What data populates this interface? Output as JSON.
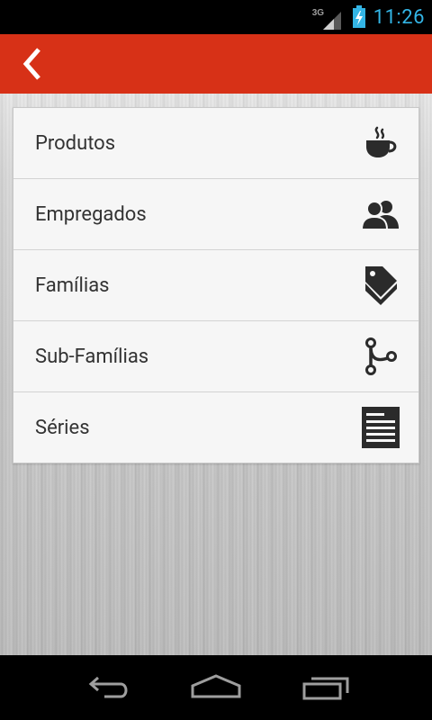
{
  "status_bar": {
    "network": "3G",
    "time": "11:26"
  },
  "action_bar": {
    "back_icon": "chevron-left-icon"
  },
  "menu": {
    "items": [
      {
        "label": "Produtos",
        "icon": "coffee-cup-icon"
      },
      {
        "label": "Empregados",
        "icon": "users-icon"
      },
      {
        "label": "Famílias",
        "icon": "tags-icon"
      },
      {
        "label": "Sub-Famílias",
        "icon": "branch-icon"
      },
      {
        "label": "Séries",
        "icon": "document-lines-icon"
      }
    ]
  },
  "nav_bar": {
    "buttons": [
      "back-icon",
      "home-icon",
      "recent-apps-icon"
    ]
  },
  "colors": {
    "action_bar": "#d73117",
    "clock": "#33b5e5",
    "icon": "#2b2b2b",
    "label": "#333333"
  }
}
